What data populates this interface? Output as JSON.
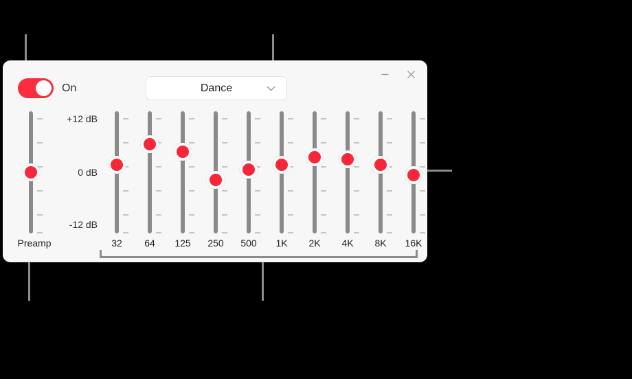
{
  "window": {
    "minimize_icon": "minimize-icon",
    "close_icon": "close-icon"
  },
  "toggle": {
    "label": "On",
    "state": "on",
    "accent_color": "#FA2D3E"
  },
  "preset": {
    "value": "Dance",
    "chevron_icon": "chevron-down-icon"
  },
  "scale": {
    "labels": [
      "+12 dB",
      "0 dB",
      "-12 dB"
    ],
    "max_db": 12,
    "min_db": -12
  },
  "preamp": {
    "caption": "Preamp",
    "value_db": 0
  },
  "bands": [
    {
      "label": "32",
      "value_db": 1.5
    },
    {
      "label": "64",
      "value_db": 5.5
    },
    {
      "label": "125",
      "value_db": 4.0
    },
    {
      "label": "250",
      "value_db": -1.5
    },
    {
      "label": "500",
      "value_db": 0.5
    },
    {
      "label": "1K",
      "value_db": 1.5
    },
    {
      "label": "2K",
      "value_db": 3.0
    },
    {
      "label": "4K",
      "value_db": 2.5
    },
    {
      "label": "8K",
      "value_db": 1.5
    },
    {
      "label": "16K",
      "value_db": -0.5
    }
  ],
  "annotations": {
    "callout_toggle": "callout-line-toggle",
    "callout_preset": "callout-line-preset",
    "callout_preamp": "callout-line-preamp",
    "callout_bands": "callout-line-bands",
    "callout_band_slider": "callout-line-band-slider"
  }
}
